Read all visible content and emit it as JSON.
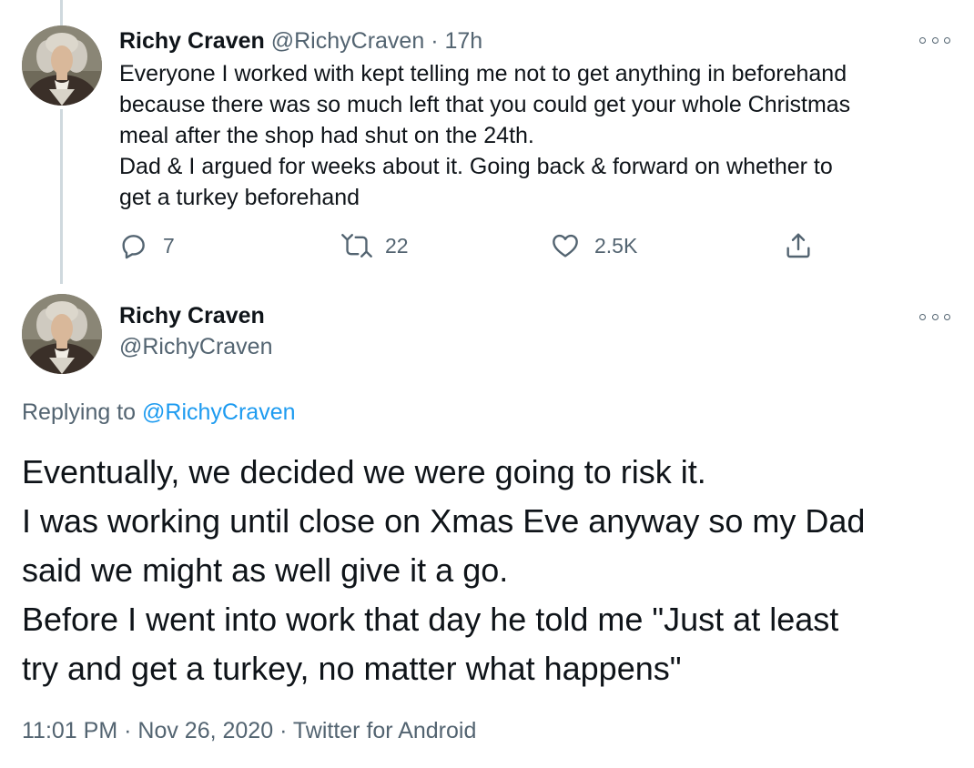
{
  "reply_tweet": {
    "author_name": "Richy Craven",
    "handle": "@RichyCraven",
    "separator": "·",
    "time": "17h",
    "lines": [
      "Everyone I worked with kept telling me not to get anything in beforehand",
      "because there was so much left that you could get your whole Christmas",
      "meal after the shop had shut on the 24th.",
      "Dad & I argued for weeks about it. Going back & forward on whether to",
      "get a turkey beforehand"
    ],
    "actions": {
      "reply_count": "7",
      "retweet_count": "22",
      "like_count": "2.5K"
    }
  },
  "main_tweet": {
    "author_name": "Richy Craven",
    "handle": "@RichyCraven",
    "replying_prefix": "Replying to",
    "replying_handle": "@RichyCraven",
    "lines": [
      "Eventually, we decided we were going to risk it.",
      "I was working until close on Xmas Eve anyway so my Dad",
      "said we might as well give it a go.",
      "Before I went into work that day he told me \"Just at least",
      "try and get a turkey, no matter what happens\""
    ],
    "time": "11:01 PM",
    "date": "Nov 26, 2020",
    "source": "Twitter for Android",
    "meta_separator": "·"
  },
  "icons": {
    "reply": "reply-icon",
    "retweet": "retweet-icon",
    "like": "heart-icon",
    "share": "share-icon",
    "more": "more-icon"
  },
  "colors": {
    "text": "#0f1419",
    "secondary": "#536471",
    "link": "#1d9bf0",
    "thread_line": "#cfd9de"
  }
}
